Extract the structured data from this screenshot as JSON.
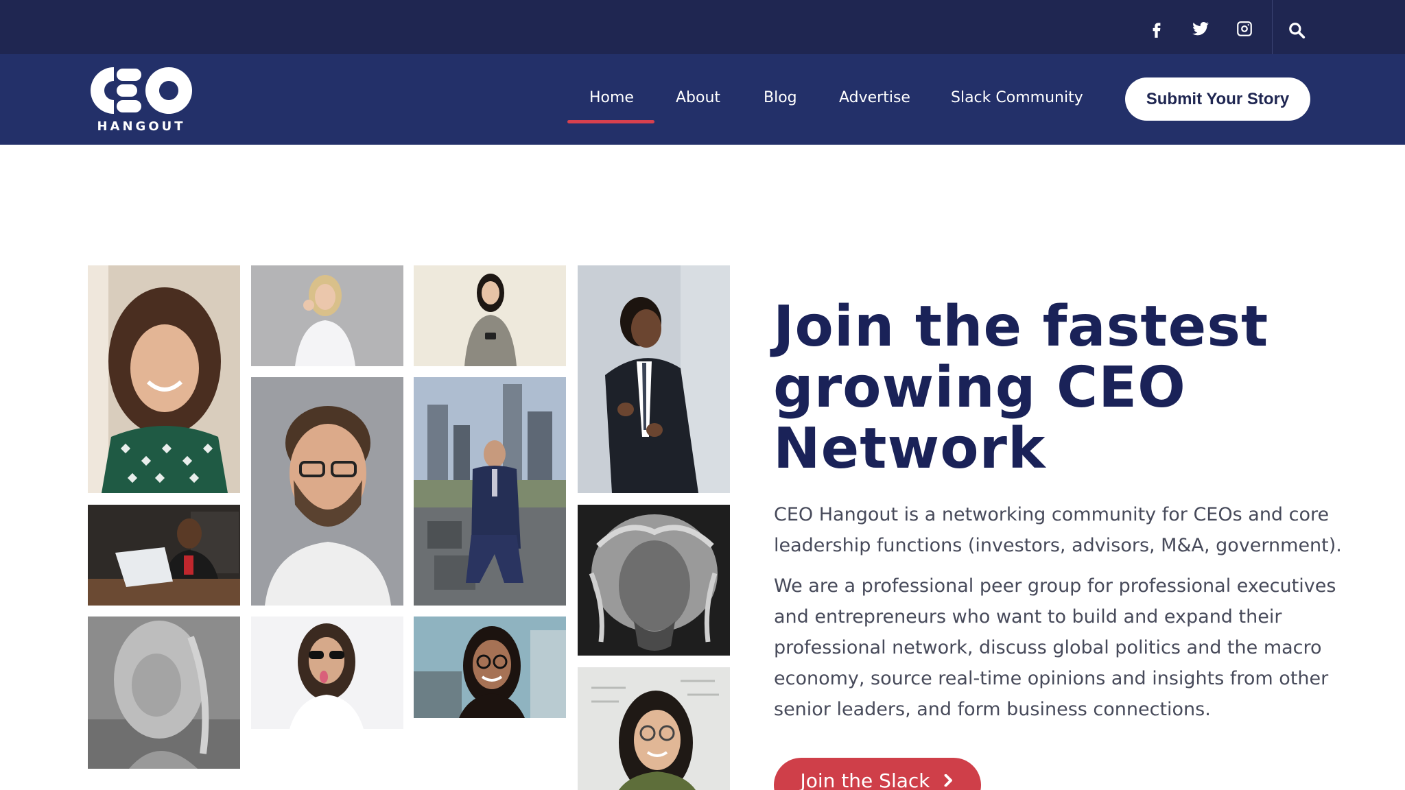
{
  "colors": {
    "topbar": "#1f2651",
    "navbar": "#233069",
    "accent_red": "#cf3f49",
    "title_navy": "#1a2258",
    "body_text": "#474a5a"
  },
  "topbar": {
    "social_icons": [
      "facebook-icon",
      "twitter-icon",
      "instagram-icon"
    ],
    "search_icon": "search-icon"
  },
  "brand": {
    "logo_letters": "CEO",
    "logo_subtext": "HANGOUT"
  },
  "nav": {
    "items": [
      {
        "label": "Home",
        "active": true
      },
      {
        "label": "About",
        "active": false
      },
      {
        "label": "Blog",
        "active": false
      },
      {
        "label": "Advertise",
        "active": false
      },
      {
        "label": "Slack Community",
        "active": false
      }
    ],
    "submit_label": "Submit Your Story"
  },
  "hero": {
    "title_lines": [
      "Join the fastest",
      "growing CEO",
      "Network"
    ],
    "paragraph1": "CEO Hangout is a networking community for CEOs and core leadership functions (investors, advisors, M&A, government).",
    "paragraph2": "We are a professional peer group for professional executives and entrepreneurs who want to build and expand their professional network, discuss global politics and the macro economy, source real-time opinions and insights from other senior leaders, and form business connections.",
    "cta_label": "Join the Slack",
    "cta_icon": "chevron-right-icon"
  },
  "mosaic": {
    "photos": [
      "photo-curly-haired-woman",
      "photo-laptop-man",
      "photo-blonde-woman-bw",
      "photo-blonde-woman-ok-sign",
      "photo-bearded-man-glasses",
      "photo-sunglasses-person",
      "photo-woman-with-phone",
      "photo-suited-man-rooftop",
      "photo-woman-glasses-street",
      "photo-man-black-suit",
      "photo-long-haired-man-bw",
      "photo-woman-glasses-whiteboard"
    ]
  }
}
